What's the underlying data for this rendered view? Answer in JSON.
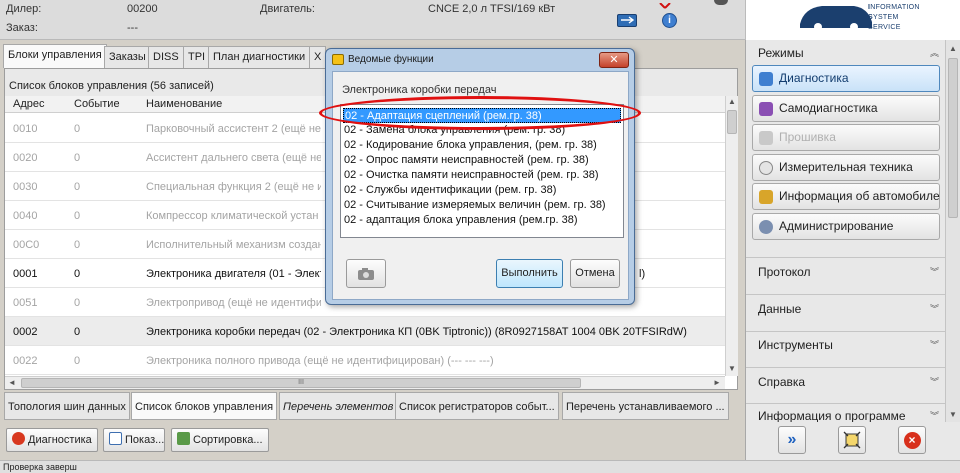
{
  "header": {
    "dealer_label": "Дилер:",
    "dealer_value": "00200",
    "order_label": "Заказ:",
    "order_value": "---",
    "engine_label": "Двигатель:",
    "engine_value": "CNCE 2,0 л TFSI/169 кВт"
  },
  "logo": {
    "lines": [
      "NFORMATION",
      "YSTEM",
      "SERVICE"
    ],
    "letters": [
      "I",
      "S",
      ""
    ]
  },
  "tabs": [
    {
      "label": "Блоки управления"
    },
    {
      "label": "Заказы"
    },
    {
      "label": "DISS"
    },
    {
      "label": "TPI"
    },
    {
      "label": "План диагностики"
    },
    {
      "label": "Х"
    }
  ],
  "list": {
    "title": "Список блоков управления (56 записей)",
    "columns": [
      "Адрес",
      "Событие",
      "Наименование"
    ],
    "rows": [
      {
        "addr": "0010",
        "event": "0",
        "name": "Парковочный ассистент 2 (ещё не"
      },
      {
        "addr": "0020",
        "event": "0",
        "name": "Ассистент дальнего света (ещё не"
      },
      {
        "addr": "0030",
        "event": "0",
        "name": "Специальная функция 2 (ещё не и"
      },
      {
        "addr": "0040",
        "event": "0",
        "name": "Компрессор климатической устан"
      },
      {
        "addr": "00C0",
        "event": "0",
        "name": "Исполнительный механизм создан"
      },
      {
        "addr": "0001",
        "event": "0",
        "name": "Электроника двигателя (01 - Элект",
        "tail": "l)"
      },
      {
        "addr": "0051",
        "event": "0",
        "name": "Электропривод (ещё не идентифи"
      },
      {
        "addr": "0002",
        "event": "0",
        "name": "Электроника коробки передач (02 - Электроника КП (0BK Tiptronic)) (8R0927158AT   1004   0BK 20TFSIRdW)"
      },
      {
        "addr": "0022",
        "event": "0",
        "name": "Электроника полного привода (ещё не идентифицирован) (---   ---   ---)"
      }
    ],
    "hscroll_grip": "III"
  },
  "bottom_tabs": [
    {
      "label": "Топология шин данных"
    },
    {
      "label": "Список блоков управления"
    },
    {
      "label": "Перечень элементов"
    },
    {
      "label": "Список регистраторов событ..."
    },
    {
      "label": "Перечень устанавливаемого ..."
    }
  ],
  "bottom_buttons": [
    {
      "label": "Диагностика"
    },
    {
      "label": "Показ..."
    },
    {
      "label": "Сортировка..."
    }
  ],
  "status": "Проверка заверш",
  "right_panel": {
    "modes_title": "Режимы",
    "modes": [
      {
        "label": "Диагностика"
      },
      {
        "label": "Самодиагностика"
      },
      {
        "label": "Прошивка"
      },
      {
        "label": "Измерительная техника"
      },
      {
        "label": "Информация об автомобиле"
      },
      {
        "label": "Администрирование"
      }
    ],
    "sections": [
      {
        "label": "Протокол"
      },
      {
        "label": "Данные"
      },
      {
        "label": "Инструменты"
      },
      {
        "label": "Справка"
      },
      {
        "label": "Информация о программе"
      }
    ]
  },
  "dialog": {
    "title": "Ведомые функции",
    "caption": "Электроника коробки передач",
    "options": [
      "02 - Адаптация сцеплений (рем.гр. 38)",
      "02 - Замена блока управления (рем. гр. 38)",
      "02 - Кодирование блока управления, (рем. гр. 38)",
      "02 - Опрос памяти неисправностей (рем. гр. 38)",
      "02 - Очистка памяти неисправностей (рем. гр. 38)",
      "02 - Службы идентификации (рем. гр. 38)",
      "02 - Считывание измеряемых величин (рем. гр. 38)",
      "02 - адаптация блока управления (рем.гр. 38)"
    ],
    "selected_index": 0,
    "execute_label": "Выполнить",
    "cancel_label": "Отмена"
  },
  "colors": {
    "selection": "#3399ff",
    "highlight_oval": "#e01010",
    "active_mode": "#c9e2f8"
  }
}
